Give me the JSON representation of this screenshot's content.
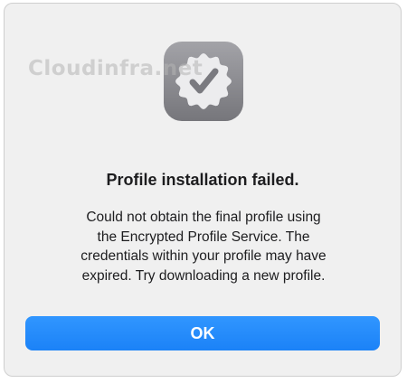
{
  "dialog": {
    "icon": "verified-badge-icon",
    "watermark": "Cloudinfra.net",
    "title": "Profile installation failed.",
    "message_lines": [
      "Could not obtain the final profile using",
      "the Encrypted Profile Service. The",
      "credentials within your profile may have",
      "expired. Try downloading a new profile."
    ],
    "ok_label": "OK"
  },
  "colors": {
    "dialog_background": "#f0f0f0",
    "button_accent": "#1b82f7",
    "icon_tile": "#8e8e93",
    "icon_badge": "#ececee"
  }
}
